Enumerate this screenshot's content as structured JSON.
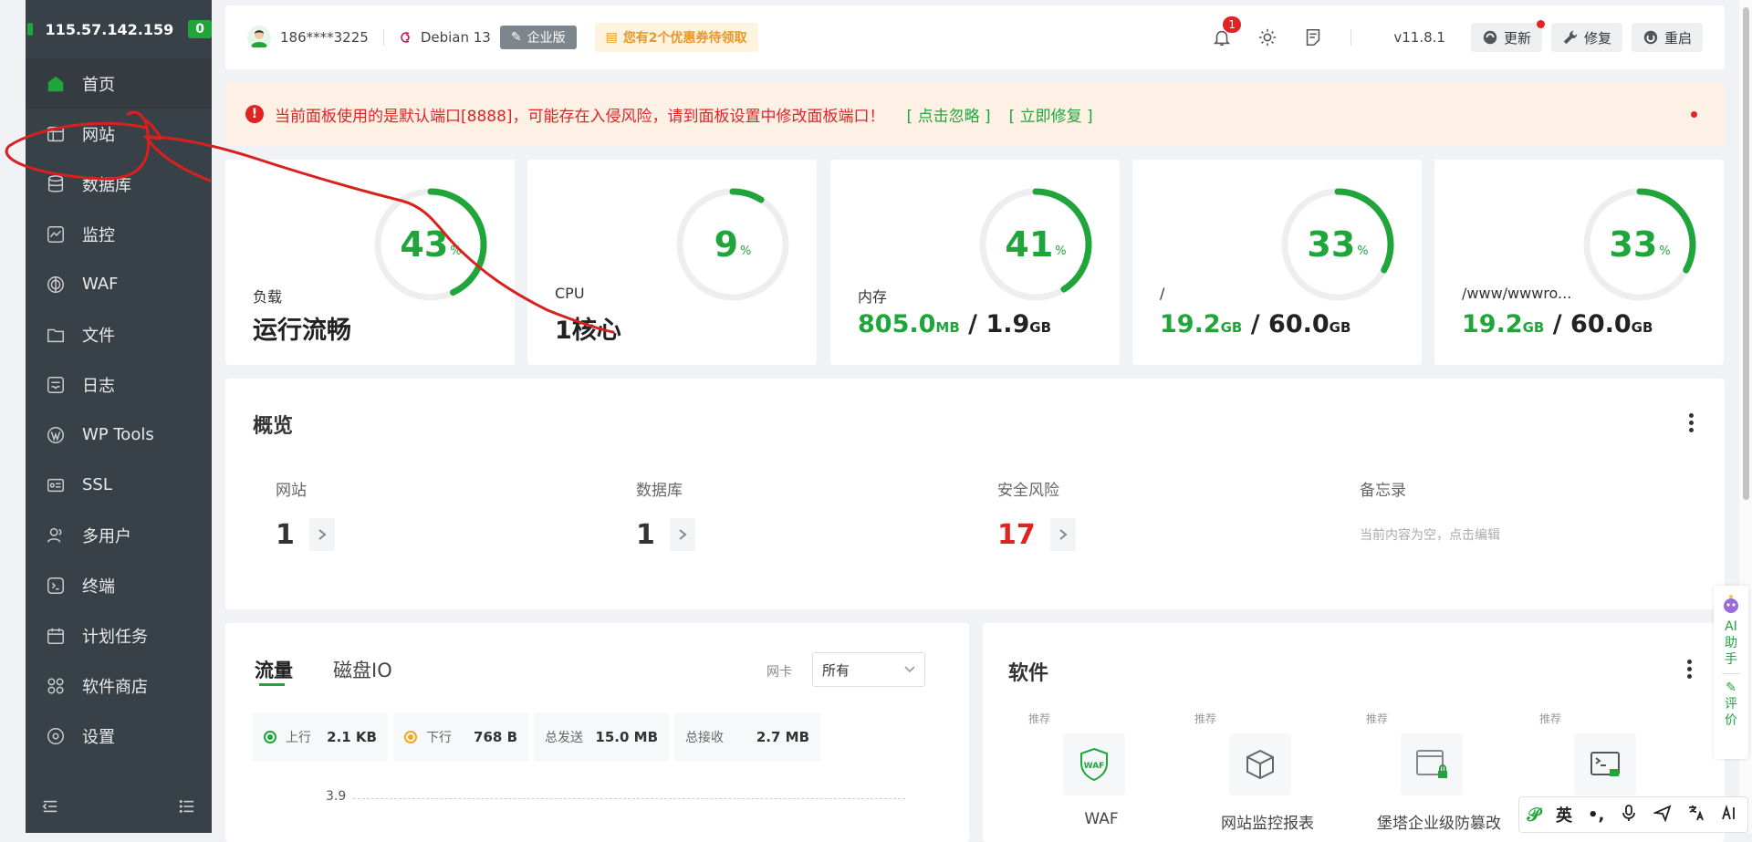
{
  "sidebar": {
    "server_ip": "115.57.142.159",
    "badge": "0",
    "items": [
      {
        "label": "首页",
        "icon": "home-icon"
      },
      {
        "label": "网站",
        "icon": "website-icon"
      },
      {
        "label": "数据库",
        "icon": "database-icon"
      },
      {
        "label": "监控",
        "icon": "monitor-icon"
      },
      {
        "label": "WAF",
        "icon": "waf-icon"
      },
      {
        "label": "文件",
        "icon": "folder-icon"
      },
      {
        "label": "日志",
        "icon": "log-icon"
      },
      {
        "label": "WP Tools",
        "icon": "wordpress-icon"
      },
      {
        "label": "SSL",
        "icon": "ssl-icon"
      },
      {
        "label": "多用户",
        "icon": "users-icon"
      },
      {
        "label": "终端",
        "icon": "terminal-icon"
      },
      {
        "label": "计划任务",
        "icon": "calendar-icon"
      },
      {
        "label": "软件商店",
        "icon": "store-icon"
      },
      {
        "label": "设置",
        "icon": "settings-icon"
      }
    ]
  },
  "header": {
    "user": "186****3225",
    "os": "Debian 13",
    "edition": "企业版",
    "coupon": "您有2个优惠券待领取",
    "notifications": "1",
    "version": "v11.8.1",
    "update_label": "更新",
    "repair_label": "修复",
    "restart_label": "重启"
  },
  "alert": {
    "text": "当前面板使用的是默认端口[8888]，可能存在入侵风险，请到面板设置中修改面板端口！",
    "ignore_link": "[ 点击忽略 ]",
    "fix_link": "[ 立即修复 ]"
  },
  "stats": {
    "load": {
      "percent": "43",
      "unit": "%",
      "label": "负载",
      "value": "运行流畅",
      "fraction": 0.43
    },
    "cpu": {
      "percent": "9",
      "unit": "%",
      "label": "CPU",
      "value": "1核心",
      "fraction": 0.09
    },
    "mem": {
      "percent": "41",
      "unit": "%",
      "label": "内存",
      "used": "805.0",
      "used_unit": "MB",
      "total": "1.9",
      "total_unit": "GB",
      "fraction": 0.41
    },
    "disk_root": {
      "percent": "33",
      "unit": "%",
      "label": "/",
      "used": "19.2",
      "used_unit": "GB",
      "total": "60.0",
      "total_unit": "GB",
      "fraction": 0.33
    },
    "disk_www": {
      "percent": "33",
      "unit": "%",
      "label": "/www/wwwro...",
      "used": "19.2",
      "used_unit": "GB",
      "total": "60.0",
      "total_unit": "GB",
      "fraction": 0.33
    }
  },
  "overview": {
    "title": "概览",
    "sites_label": "网站",
    "sites_value": "1",
    "db_label": "数据库",
    "db_value": "1",
    "risk_label": "安全风险",
    "risk_value": "17",
    "memo_label": "备忘录",
    "memo_text": "当前内容为空，点击编辑"
  },
  "traffic": {
    "tab_flow": "流量",
    "tab_disk": "磁盘IO",
    "nic_label": "网卡",
    "nic_value": "所有",
    "up_label": "上行",
    "up_value": "2.1 KB",
    "down_label": "下行",
    "down_value": "768 B",
    "sent_label": "总发送",
    "sent_value": "15.0 MB",
    "recv_label": "总接收",
    "recv_value": "2.7 MB",
    "y_tick": "3.9",
    "up_color": "#20a53a",
    "down_color": "#f5a623"
  },
  "software": {
    "title": "软件",
    "items": [
      {
        "tag": "推荐",
        "name": "WAF",
        "icon": "waf-shield-icon"
      },
      {
        "tag": "推荐",
        "name": "网站监控报表",
        "icon": "cube-icon"
      },
      {
        "tag": "推荐",
        "name": "堡塔企业级防篡改",
        "icon": "lock-window-icon"
      },
      {
        "tag": "推荐",
        "name": "",
        "icon": "terminal-lock-icon"
      }
    ]
  },
  "ai_widget": {
    "line1": "AI",
    "line2": "助",
    "line3": "手",
    "line4": "评",
    "line5": "价"
  },
  "ime": {
    "lang": "英",
    "dots": "•,"
  },
  "colors": {
    "accent": "#20a53a",
    "danger": "#e02424",
    "sidebar": "#394148"
  }
}
